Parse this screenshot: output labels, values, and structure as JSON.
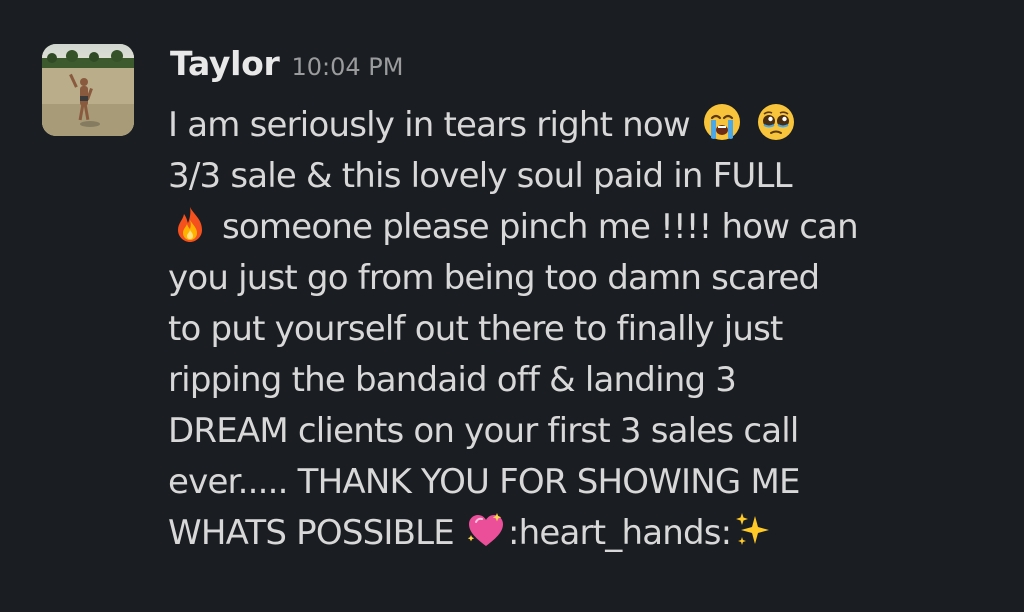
{
  "message": {
    "sender": "Taylor",
    "timestamp": "10:04 PM",
    "lines": [
      {
        "a": "I am seriously in tears right now ",
        "b": "",
        "c": ""
      },
      {
        "a": "3/3 sale & this lovely soul paid in FULL",
        "b": "",
        "c": ""
      },
      {
        "a": " someone please pinch me !!!! how can",
        "b": "",
        "c": ""
      },
      {
        "a": "you just go from being too damn scared",
        "b": "",
        "c": ""
      },
      {
        "a": "to put yourself out there to finally just",
        "b": "",
        "c": ""
      },
      {
        "a": "ripping the bandaid off & landing 3",
        "b": "",
        "c": ""
      },
      {
        "a": "DREAM clients on your first 3 sales call",
        "b": "",
        "c": ""
      },
      {
        "a": "ever..... THANK YOU FOR SHOWING ME",
        "b": "",
        "c": ""
      },
      {
        "a": "WHATS POSSIBLE ",
        "b": ":heart_hands:",
        "c": ""
      }
    ],
    "emojis": [
      "loudly-crying-face-icon",
      "pleading-face-icon",
      "fire-icon",
      "sparkling-heart-icon",
      "sparkles-icon"
    ]
  },
  "colors": {
    "background": "#1a1d21",
    "text": "#d8d8d8",
    "sender": "#e8e8e8",
    "timestamp": "#9a9b9d"
  }
}
